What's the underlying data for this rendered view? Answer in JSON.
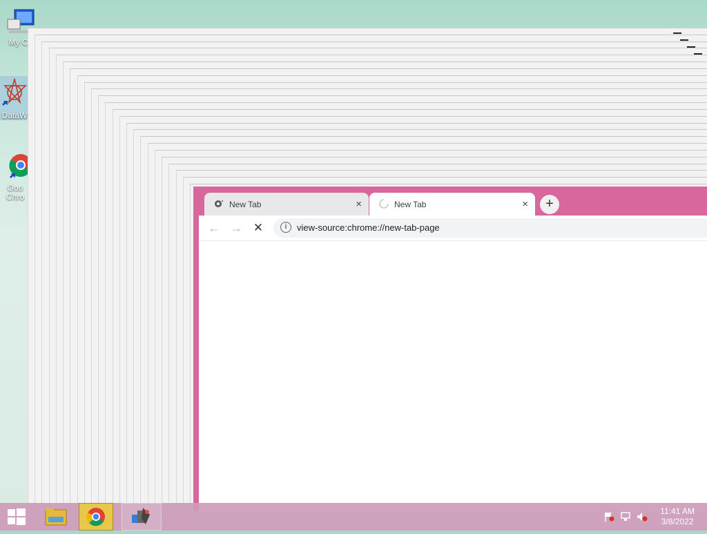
{
  "desktop": {
    "icons": [
      {
        "label": "My Co"
      },
      {
        "label": "DataW"
      },
      {
        "label": "Goo Chro"
      }
    ]
  },
  "browser": {
    "tabs": [
      {
        "title": "New Tab",
        "close": "×"
      },
      {
        "title": "New Tab",
        "close": "×"
      }
    ],
    "new_tab": "+",
    "toolbar": {
      "back": "←",
      "forward": "→",
      "stop": "✕"
    },
    "address": "view-source:chrome://new-tab-page",
    "info_glyph": "i"
  },
  "taskbar": {
    "time": "11:41 AM",
    "date": "3/8/2022"
  },
  "colors": {
    "browser_frame": "#d8679e",
    "taskbar": "#cd9bb9"
  }
}
